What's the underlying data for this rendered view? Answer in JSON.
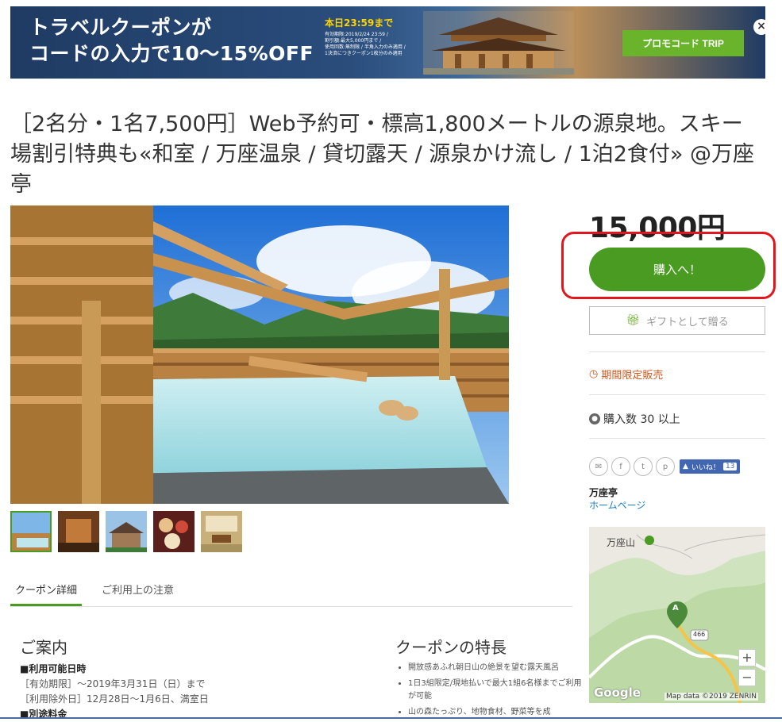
{
  "banner": {
    "title": "トラベルクーポンが\nコードの入力で10〜15%OFF",
    "deadline": "本日23:59まで",
    "fine_print": "有効期限:2019/2/24 23:59 /\n割引額:最大5,000円まで /\n使用回数:無制限 / 半角入力のみ適用 /\n1決済につきクーポン1枚分のみ適用",
    "promo_button": "プロモコード TRIP",
    "close_icon": "close-icon"
  },
  "deal": {
    "title": "［2名分・1名7,500円］Web予約可・標高1,800メートルの源泉地。スキー場割引特典も«和室 / 万座温泉 / 貸切露天 / 源泉かけ流し / 1泊2食付» @万座亭"
  },
  "tabs": [
    {
      "label": "クーポン詳細"
    },
    {
      "label": "ご利用上の注意"
    }
  ],
  "guide": {
    "heading": "ご案内",
    "period_label": "■利用可能日時",
    "period_value": "［有効期限］〜2019年3月31日（日）まで",
    "excluded_value": "［利用除外日］12月28日〜1月6日、満室日",
    "extra_fee_label": "■別途料金"
  },
  "features": {
    "heading": "クーポンの特長",
    "items": [
      "開放感あふれ朝日山の絶景を望む露天風呂",
      "1日3組限定/現地払いで最大1組6名様までご利用が可能",
      "山の森たっぷり、地物食材、野菜等を成"
    ]
  },
  "sidebar": {
    "price": "15,000円",
    "buy_label": "購入へ！",
    "gift_label": "ギフトとして贈る",
    "limited_label": "期間限定販売",
    "bought_label": "購入数 30 以上",
    "like_label": "いいね！",
    "like_count": "13",
    "shop_name": "万座亭",
    "homepage_label": "ホームページ"
  },
  "map": {
    "place_label": "万座山",
    "route_number": "466",
    "attribution": "Map data ©2019 ZENRIN",
    "google_label": "Google",
    "zoom_in": "+",
    "zoom_out": "−"
  },
  "colors": {
    "accent_green": "#4a9b22",
    "highlight_red": "#e2161c",
    "limited_orange": "#d2551a",
    "link_blue": "#1a7fc9"
  }
}
